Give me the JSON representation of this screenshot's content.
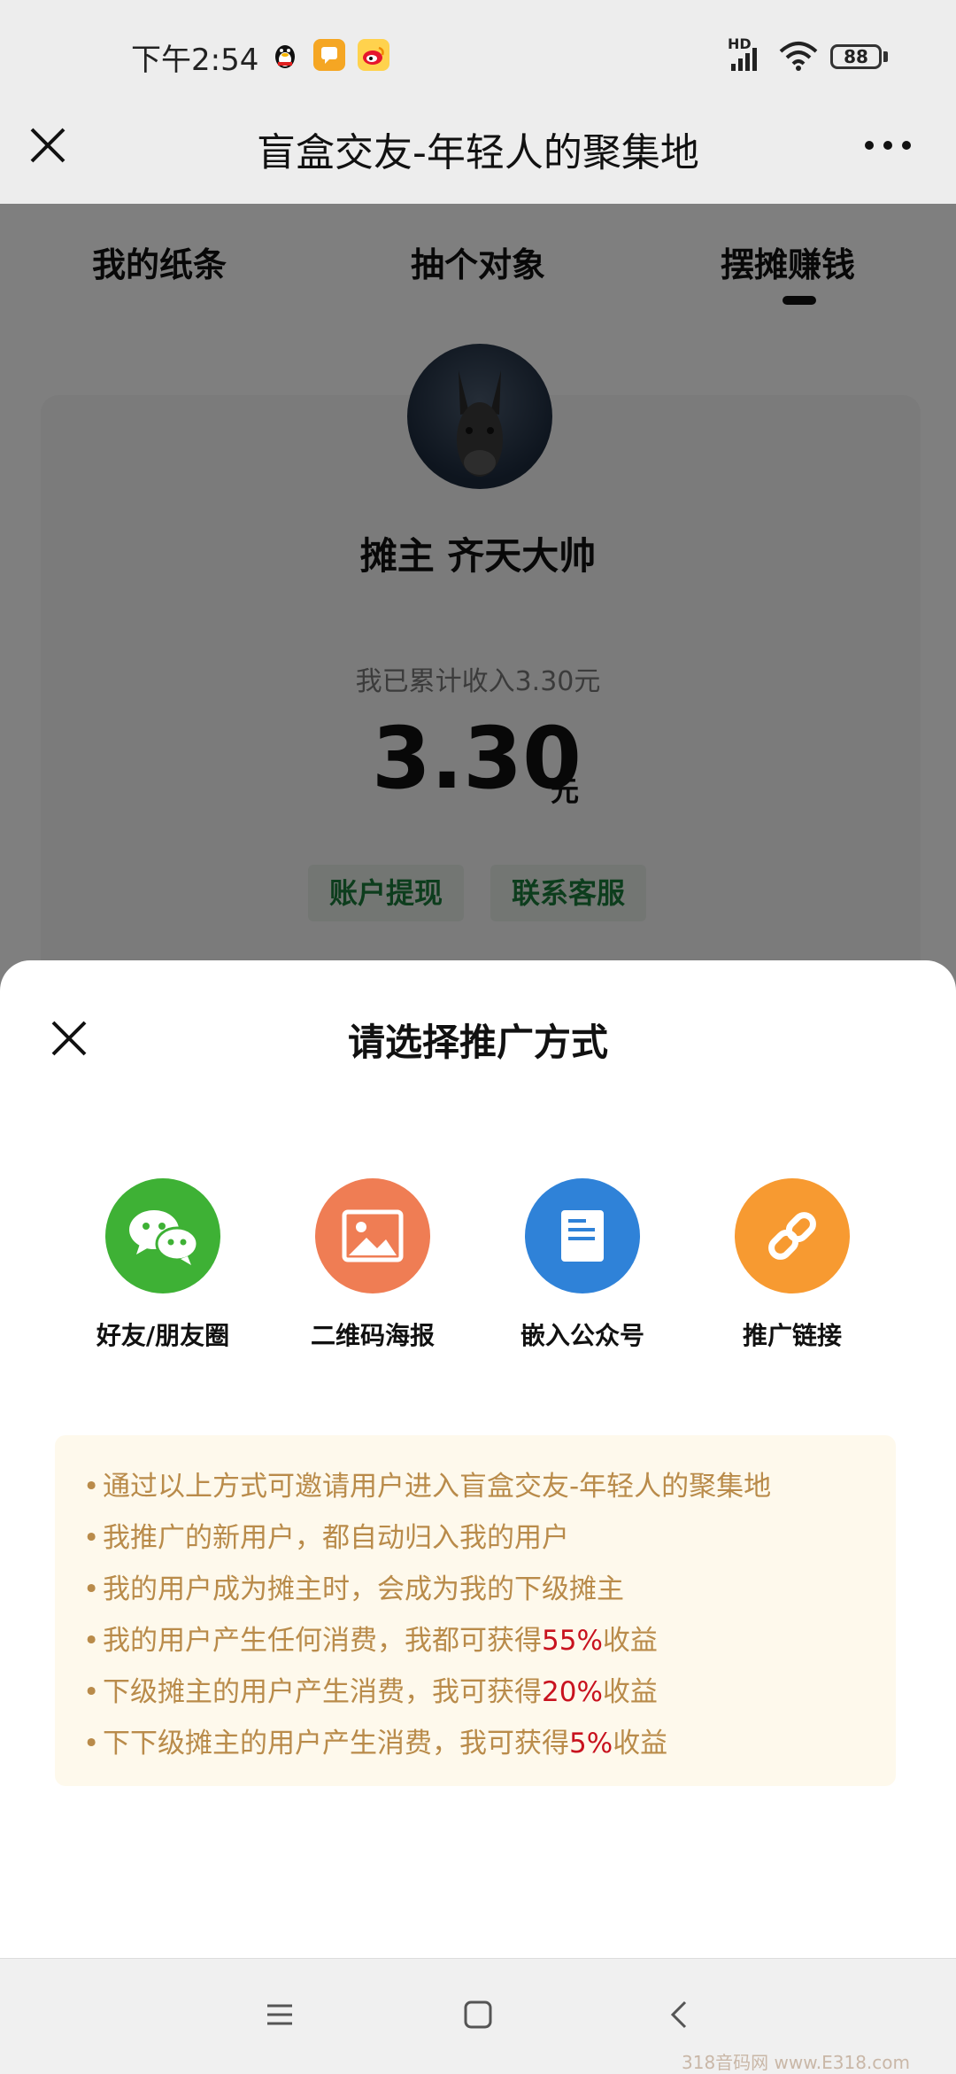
{
  "status_bar": {
    "time": "下午2:54",
    "app_icons": [
      "qq-penguin-icon",
      "orange-message-icon",
      "weibo-icon"
    ],
    "network_label": "HD",
    "battery": "88"
  },
  "title_bar": {
    "title": "盲盒交友-年轻人的聚集地"
  },
  "tabs": [
    {
      "label": "我的纸条"
    },
    {
      "label": "抽个对象"
    },
    {
      "label": "摆摊赚钱",
      "active": true
    }
  ],
  "profile": {
    "name": "摊主 齐天大帅",
    "income_label": "我已累计收入3.30元",
    "income_value": "3.30",
    "income_unit": "元",
    "withdraw_label": "账户提现",
    "contact_label": "联系客服"
  },
  "sheet": {
    "title": "请选择推广方式",
    "options": [
      {
        "label": "好友/朋友圈",
        "icon": "wechat-icon",
        "color": "#3eb135"
      },
      {
        "label": "二维码海报",
        "icon": "image-poster-icon",
        "color": "#ef7d54"
      },
      {
        "label": "嵌入公众号",
        "icon": "document-icon",
        "color": "#2f82d8"
      },
      {
        "label": "推广链接",
        "icon": "link-icon",
        "color": "#f79a31"
      }
    ],
    "info": [
      {
        "text": "通过以上方式可邀请用户进入盲盒交友-年轻人的聚集地",
        "pct": "",
        "suffix": ""
      },
      {
        "text": "我推广的新用户，都自动归入我的用户",
        "pct": "",
        "suffix": ""
      },
      {
        "text": "我的用户成为摊主时，会成为我的下级摊主",
        "pct": "",
        "suffix": ""
      },
      {
        "text": "我的用户产生任何消费，我都可获得",
        "pct": "55%",
        "suffix": "收益"
      },
      {
        "text": "下级摊主的用户产生消费，我可获得",
        "pct": "20%",
        "suffix": "收益"
      },
      {
        "text": "下下级摊主的用户产生消费，我可获得",
        "pct": "5%",
        "suffix": "收益"
      }
    ]
  },
  "colors": {
    "accent_green": "#1a7a3a",
    "info_text": "#b98b4a",
    "highlight_red": "#c8121e",
    "info_bg": "#fef9ec"
  },
  "watermark": "318音码网 www.E318.com"
}
